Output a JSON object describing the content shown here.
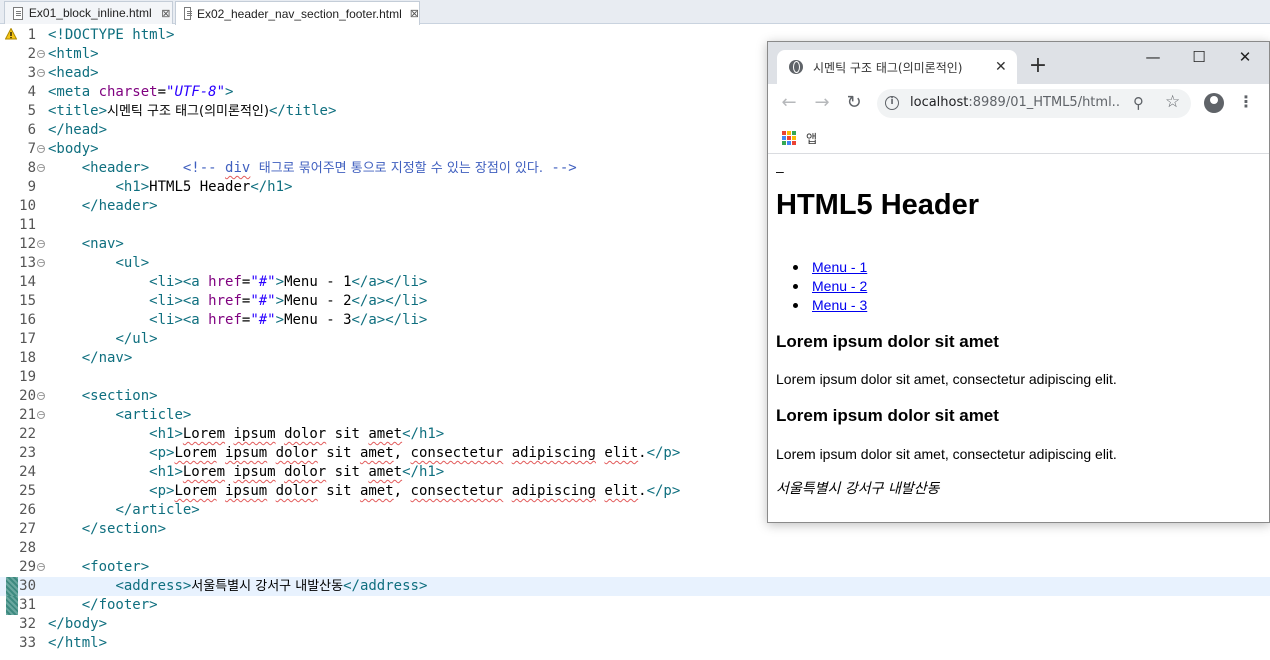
{
  "editor_tabs": [
    {
      "label": "Ex01_block_inline.html",
      "close": "⊠"
    },
    {
      "label": "Ex02_header_nav_section_footer.html",
      "close": "⊠"
    }
  ],
  "code_lines": [
    {
      "n": "1",
      "parts": [
        [
          "t",
          "<!DOCTYPE html>"
        ]
      ]
    },
    {
      "n": "2",
      "fold": true,
      "parts": [
        [
          "t",
          "<html>"
        ]
      ]
    },
    {
      "n": "3",
      "fold": true,
      "parts": [
        [
          "t",
          "<head>"
        ]
      ]
    },
    {
      "n": "4",
      "parts": [
        [
          "t",
          "<meta "
        ],
        [
          "at",
          "charset"
        ],
        [
          "",
          "="
        ],
        [
          "av",
          "\"UTF-8\""
        ],
        [
          "t",
          ">"
        ]
      ]
    },
    {
      "n": "5",
      "parts": [
        [
          "t",
          "<title>"
        ],
        [
          "kr",
          "시멘틱 구조 태그(의미론적인)"
        ],
        [
          "t",
          "</title>"
        ]
      ]
    },
    {
      "n": "6",
      "parts": [
        [
          "t",
          "</head>"
        ]
      ]
    },
    {
      "n": "7",
      "fold": true,
      "parts": [
        [
          "t",
          "<body>"
        ]
      ]
    },
    {
      "n": "8",
      "fold": true,
      "parts": [
        [
          "",
          "    "
        ],
        [
          "t",
          "<header>"
        ],
        [
          "",
          "    "
        ],
        [
          "cm",
          "<!-- "
        ],
        [
          "cm sq",
          "div"
        ],
        [
          "cm",
          " "
        ],
        [
          "cm kr",
          "태그로 묶어주면 통으로 지정할 수 있는 장점이 있다."
        ],
        [
          "cm",
          " -->"
        ]
      ]
    },
    {
      "n": "9",
      "parts": [
        [
          "",
          "        "
        ],
        [
          "t",
          "<h1>"
        ],
        [
          "",
          "HTML5 Header"
        ],
        [
          "t",
          "</h1>"
        ]
      ]
    },
    {
      "n": "10",
      "parts": [
        [
          "",
          "    "
        ],
        [
          "t",
          "</header>"
        ]
      ]
    },
    {
      "n": "11",
      "parts": []
    },
    {
      "n": "12",
      "fold": true,
      "parts": [
        [
          "",
          "    "
        ],
        [
          "t",
          "<nav>"
        ]
      ]
    },
    {
      "n": "13",
      "fold": true,
      "parts": [
        [
          "",
          "        "
        ],
        [
          "t",
          "<ul>"
        ]
      ]
    },
    {
      "n": "14",
      "parts": [
        [
          "",
          "            "
        ],
        [
          "t",
          "<li><a "
        ],
        [
          "at",
          "href"
        ],
        [
          "",
          "="
        ],
        [
          "av",
          "\"#\""
        ],
        [
          "t",
          ">"
        ],
        [
          "",
          "Menu - 1"
        ],
        [
          "t",
          "</a></li>"
        ]
      ]
    },
    {
      "n": "15",
      "parts": [
        [
          "",
          "            "
        ],
        [
          "t",
          "<li><a "
        ],
        [
          "at",
          "href"
        ],
        [
          "",
          "="
        ],
        [
          "av",
          "\"#\""
        ],
        [
          "t",
          ">"
        ],
        [
          "",
          "Menu - 2"
        ],
        [
          "t",
          "</a></li>"
        ]
      ]
    },
    {
      "n": "16",
      "parts": [
        [
          "",
          "            "
        ],
        [
          "t",
          "<li><a "
        ],
        [
          "at",
          "href"
        ],
        [
          "",
          "="
        ],
        [
          "av",
          "\"#\""
        ],
        [
          "t",
          ">"
        ],
        [
          "",
          "Menu - 3"
        ],
        [
          "t",
          "</a></li>"
        ]
      ]
    },
    {
      "n": "17",
      "parts": [
        [
          "",
          "        "
        ],
        [
          "t",
          "</ul>"
        ]
      ]
    },
    {
      "n": "18",
      "parts": [
        [
          "",
          "    "
        ],
        [
          "t",
          "</nav>"
        ]
      ]
    },
    {
      "n": "19",
      "parts": []
    },
    {
      "n": "20",
      "fold": true,
      "parts": [
        [
          "",
          "    "
        ],
        [
          "t",
          "<section>"
        ]
      ]
    },
    {
      "n": "21",
      "fold": true,
      "parts": [
        [
          "",
          "        "
        ],
        [
          "t",
          "<article>"
        ]
      ]
    },
    {
      "n": "22",
      "parts": [
        [
          "",
          "            "
        ],
        [
          "t",
          "<h1>"
        ],
        [
          "sq",
          "Lorem"
        ],
        [
          "",
          " "
        ],
        [
          "sq",
          "ipsum"
        ],
        [
          "",
          " "
        ],
        [
          "sq",
          "dolor"
        ],
        [
          "",
          " sit "
        ],
        [
          "sq",
          "amet"
        ],
        [
          "t",
          "</h1>"
        ]
      ]
    },
    {
      "n": "23",
      "parts": [
        [
          "",
          "            "
        ],
        [
          "t",
          "<p>"
        ],
        [
          "sq",
          "Lorem"
        ],
        [
          "",
          " "
        ],
        [
          "sq",
          "ipsum"
        ],
        [
          "",
          " "
        ],
        [
          "sq",
          "dolor"
        ],
        [
          "",
          " sit "
        ],
        [
          "sq",
          "amet"
        ],
        [
          "",
          ", "
        ],
        [
          "sq",
          "consectetur"
        ],
        [
          "",
          " "
        ],
        [
          "sq",
          "adipiscing"
        ],
        [
          "",
          " "
        ],
        [
          "sq",
          "elit"
        ],
        [
          "",
          "."
        ],
        [
          "t",
          "</p>"
        ]
      ]
    },
    {
      "n": "24",
      "parts": [
        [
          "",
          "            "
        ],
        [
          "t",
          "<h1>"
        ],
        [
          "sq",
          "Lorem"
        ],
        [
          "",
          " "
        ],
        [
          "sq",
          "ipsum"
        ],
        [
          "",
          " "
        ],
        [
          "sq",
          "dolor"
        ],
        [
          "",
          " sit "
        ],
        [
          "sq",
          "amet"
        ],
        [
          "t",
          "</h1>"
        ]
      ]
    },
    {
      "n": "25",
      "parts": [
        [
          "",
          "            "
        ],
        [
          "t",
          "<p>"
        ],
        [
          "sq",
          "Lorem"
        ],
        [
          "",
          " "
        ],
        [
          "sq",
          "ipsum"
        ],
        [
          "",
          " "
        ],
        [
          "sq",
          "dolor"
        ],
        [
          "",
          " sit "
        ],
        [
          "sq",
          "amet"
        ],
        [
          "",
          ", "
        ],
        [
          "sq",
          "consectetur"
        ],
        [
          "",
          " "
        ],
        [
          "sq",
          "adipiscing"
        ],
        [
          "",
          " "
        ],
        [
          "sq",
          "elit"
        ],
        [
          "",
          "."
        ],
        [
          "t",
          "</p>"
        ]
      ]
    },
    {
      "n": "26",
      "parts": [
        [
          "",
          "        "
        ],
        [
          "t",
          "</article>"
        ]
      ]
    },
    {
      "n": "27",
      "parts": [
        [
          "",
          "    "
        ],
        [
          "t",
          "</section>"
        ]
      ]
    },
    {
      "n": "28",
      "parts": []
    },
    {
      "n": "29",
      "fold": true,
      "parts": [
        [
          "",
          "    "
        ],
        [
          "t",
          "<footer>"
        ]
      ]
    },
    {
      "n": "30",
      "current": true,
      "parts": [
        [
          "",
          "        "
        ],
        [
          "t",
          "<address>"
        ],
        [
          "kr",
          "서울특별시 강서구 내발산동"
        ],
        [
          "t",
          "</address>"
        ]
      ]
    },
    {
      "n": "31",
      "parts": [
        [
          "",
          "    "
        ],
        [
          "t",
          "</footer>"
        ]
      ]
    },
    {
      "n": "32",
      "parts": [
        [
          "t",
          "</body>"
        ]
      ]
    },
    {
      "n": "33",
      "parts": [
        [
          "t",
          "</html>"
        ]
      ]
    }
  ],
  "browser": {
    "tab_title": "시멘틱 구조 태그(의미론적인)",
    "tab_close": "✕",
    "new_tab": "+",
    "minimize": "—",
    "maximize": "☐",
    "close": "✕",
    "back": "←",
    "forward": "→",
    "reload": "↻",
    "info": "i",
    "url_host": "localhost",
    "url_rest": ":8989/01_HTML5/html...",
    "zoom": "⚲",
    "star": "☆",
    "menu": "⋮",
    "apps_label": "앱",
    "apps_colors": [
      "#ea4335",
      "#fbbc05",
      "#34a853",
      "#4285f4",
      "#ea4335",
      "#fbbc05",
      "#34a853",
      "#4285f4",
      "#ea4335"
    ]
  },
  "page": {
    "dash": "–",
    "header_title": "HTML5 Header",
    "menu_items": [
      "Menu - 1",
      "Menu - 2",
      "Menu - 3"
    ],
    "article_title_1": "Lorem ipsum dolor sit amet",
    "article_text_1": "Lorem ipsum dolor sit amet, consectetur adipiscing elit.",
    "article_title_2": "Lorem ipsum dolor sit amet",
    "article_text_2": "Lorem ipsum dolor sit amet, consectetur adipiscing elit.",
    "address": "서울특별시 강서구 내발산동"
  }
}
